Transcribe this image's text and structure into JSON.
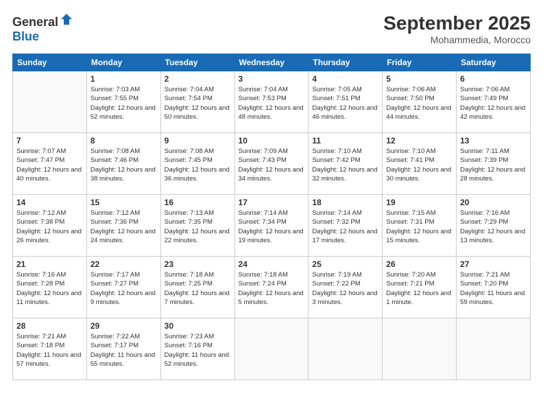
{
  "header": {
    "logo_general": "General",
    "logo_blue": "Blue",
    "month": "September 2025",
    "location": "Mohammedia, Morocco"
  },
  "days_of_week": [
    "Sunday",
    "Monday",
    "Tuesday",
    "Wednesday",
    "Thursday",
    "Friday",
    "Saturday"
  ],
  "weeks": [
    [
      {
        "num": "",
        "sunrise": "",
        "sunset": "",
        "daylight": ""
      },
      {
        "num": "1",
        "sunrise": "Sunrise: 7:03 AM",
        "sunset": "Sunset: 7:55 PM",
        "daylight": "Daylight: 12 hours and 52 minutes."
      },
      {
        "num": "2",
        "sunrise": "Sunrise: 7:04 AM",
        "sunset": "Sunset: 7:54 PM",
        "daylight": "Daylight: 12 hours and 50 minutes."
      },
      {
        "num": "3",
        "sunrise": "Sunrise: 7:04 AM",
        "sunset": "Sunset: 7:53 PM",
        "daylight": "Daylight: 12 hours and 48 minutes."
      },
      {
        "num": "4",
        "sunrise": "Sunrise: 7:05 AM",
        "sunset": "Sunset: 7:51 PM",
        "daylight": "Daylight: 12 hours and 46 minutes."
      },
      {
        "num": "5",
        "sunrise": "Sunrise: 7:06 AM",
        "sunset": "Sunset: 7:50 PM",
        "daylight": "Daylight: 12 hours and 44 minutes."
      },
      {
        "num": "6",
        "sunrise": "Sunrise: 7:06 AM",
        "sunset": "Sunset: 7:49 PM",
        "daylight": "Daylight: 12 hours and 42 minutes."
      }
    ],
    [
      {
        "num": "7",
        "sunrise": "Sunrise: 7:07 AM",
        "sunset": "Sunset: 7:47 PM",
        "daylight": "Daylight: 12 hours and 40 minutes."
      },
      {
        "num": "8",
        "sunrise": "Sunrise: 7:08 AM",
        "sunset": "Sunset: 7:46 PM",
        "daylight": "Daylight: 12 hours and 38 minutes."
      },
      {
        "num": "9",
        "sunrise": "Sunrise: 7:08 AM",
        "sunset": "Sunset: 7:45 PM",
        "daylight": "Daylight: 12 hours and 36 minutes."
      },
      {
        "num": "10",
        "sunrise": "Sunrise: 7:09 AM",
        "sunset": "Sunset: 7:43 PM",
        "daylight": "Daylight: 12 hours and 34 minutes."
      },
      {
        "num": "11",
        "sunrise": "Sunrise: 7:10 AM",
        "sunset": "Sunset: 7:42 PM",
        "daylight": "Daylight: 12 hours and 32 minutes."
      },
      {
        "num": "12",
        "sunrise": "Sunrise: 7:10 AM",
        "sunset": "Sunset: 7:41 PM",
        "daylight": "Daylight: 12 hours and 30 minutes."
      },
      {
        "num": "13",
        "sunrise": "Sunrise: 7:11 AM",
        "sunset": "Sunset: 7:39 PM",
        "daylight": "Daylight: 12 hours and 28 minutes."
      }
    ],
    [
      {
        "num": "14",
        "sunrise": "Sunrise: 7:12 AM",
        "sunset": "Sunset: 7:38 PM",
        "daylight": "Daylight: 12 hours and 26 minutes."
      },
      {
        "num": "15",
        "sunrise": "Sunrise: 7:12 AM",
        "sunset": "Sunset: 7:36 PM",
        "daylight": "Daylight: 12 hours and 24 minutes."
      },
      {
        "num": "16",
        "sunrise": "Sunrise: 7:13 AM",
        "sunset": "Sunset: 7:35 PM",
        "daylight": "Daylight: 12 hours and 22 minutes."
      },
      {
        "num": "17",
        "sunrise": "Sunrise: 7:14 AM",
        "sunset": "Sunset: 7:34 PM",
        "daylight": "Daylight: 12 hours and 19 minutes."
      },
      {
        "num": "18",
        "sunrise": "Sunrise: 7:14 AM",
        "sunset": "Sunset: 7:32 PM",
        "daylight": "Daylight: 12 hours and 17 minutes."
      },
      {
        "num": "19",
        "sunrise": "Sunrise: 7:15 AM",
        "sunset": "Sunset: 7:31 PM",
        "daylight": "Daylight: 12 hours and 15 minutes."
      },
      {
        "num": "20",
        "sunrise": "Sunrise: 7:16 AM",
        "sunset": "Sunset: 7:29 PM",
        "daylight": "Daylight: 12 hours and 13 minutes."
      }
    ],
    [
      {
        "num": "21",
        "sunrise": "Sunrise: 7:16 AM",
        "sunset": "Sunset: 7:28 PM",
        "daylight": "Daylight: 12 hours and 11 minutes."
      },
      {
        "num": "22",
        "sunrise": "Sunrise: 7:17 AM",
        "sunset": "Sunset: 7:27 PM",
        "daylight": "Daylight: 12 hours and 9 minutes."
      },
      {
        "num": "23",
        "sunrise": "Sunrise: 7:18 AM",
        "sunset": "Sunset: 7:25 PM",
        "daylight": "Daylight: 12 hours and 7 minutes."
      },
      {
        "num": "24",
        "sunrise": "Sunrise: 7:18 AM",
        "sunset": "Sunset: 7:24 PM",
        "daylight": "Daylight: 12 hours and 5 minutes."
      },
      {
        "num": "25",
        "sunrise": "Sunrise: 7:19 AM",
        "sunset": "Sunset: 7:22 PM",
        "daylight": "Daylight: 12 hours and 3 minutes."
      },
      {
        "num": "26",
        "sunrise": "Sunrise: 7:20 AM",
        "sunset": "Sunset: 7:21 PM",
        "daylight": "Daylight: 12 hours and 1 minute."
      },
      {
        "num": "27",
        "sunrise": "Sunrise: 7:21 AM",
        "sunset": "Sunset: 7:20 PM",
        "daylight": "Daylight: 11 hours and 59 minutes."
      }
    ],
    [
      {
        "num": "28",
        "sunrise": "Sunrise: 7:21 AM",
        "sunset": "Sunset: 7:18 PM",
        "daylight": "Daylight: 11 hours and 57 minutes."
      },
      {
        "num": "29",
        "sunrise": "Sunrise: 7:22 AM",
        "sunset": "Sunset: 7:17 PM",
        "daylight": "Daylight: 11 hours and 55 minutes."
      },
      {
        "num": "30",
        "sunrise": "Sunrise: 7:23 AM",
        "sunset": "Sunset: 7:16 PM",
        "daylight": "Daylight: 11 hours and 52 minutes."
      },
      {
        "num": "",
        "sunrise": "",
        "sunset": "",
        "daylight": ""
      },
      {
        "num": "",
        "sunrise": "",
        "sunset": "",
        "daylight": ""
      },
      {
        "num": "",
        "sunrise": "",
        "sunset": "",
        "daylight": ""
      },
      {
        "num": "",
        "sunrise": "",
        "sunset": "",
        "daylight": ""
      }
    ]
  ]
}
